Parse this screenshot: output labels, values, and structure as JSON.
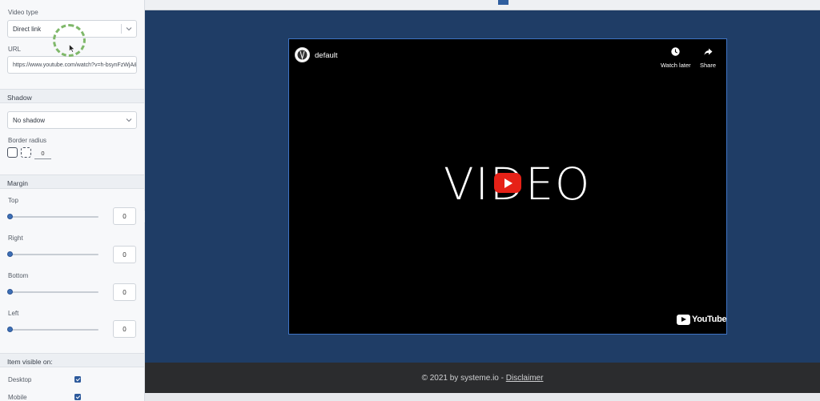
{
  "sidebar": {
    "video_type_label": "Video type",
    "video_type_value": "Direct link",
    "url_label": "URL",
    "url_value": "https://www.youtube.com/watch?v=h-bsynFzWjA&f",
    "shadow_heading": "Shadow",
    "shadow_value": "No shadow",
    "border_radius_label": "Border radius",
    "border_radius_value": "0",
    "margin_heading": "Margin",
    "margins": [
      {
        "label": "Top",
        "value": "0"
      },
      {
        "label": "Right",
        "value": "0"
      },
      {
        "label": "Bottom",
        "value": "0"
      },
      {
        "label": "Left",
        "value": "0"
      }
    ],
    "visible_heading": "Item visible on:",
    "devices": [
      {
        "label": "Desktop",
        "checked": true
      },
      {
        "label": "Mobile",
        "checked": true
      }
    ]
  },
  "video": {
    "channel_title": "default",
    "watch_later_label": "Watch later",
    "share_label": "Share",
    "thumbnail_text": "VIDEO",
    "logo_text": "YouTube"
  },
  "footer": {
    "copyright": "© 2021 by systeme.io - ",
    "disclaimer_link": "Disclaimer"
  },
  "colors": {
    "canvas_bg": "#1f3d66",
    "accent": "#2d5a9c",
    "youtube_red": "#e62117",
    "click_indicator": "#7fb86a"
  },
  "icons": [
    "chevron-down-icon",
    "clock-icon",
    "share-icon",
    "play-icon",
    "youtube-logo-icon",
    "checkbox-check-icon",
    "cursor-icon"
  ]
}
